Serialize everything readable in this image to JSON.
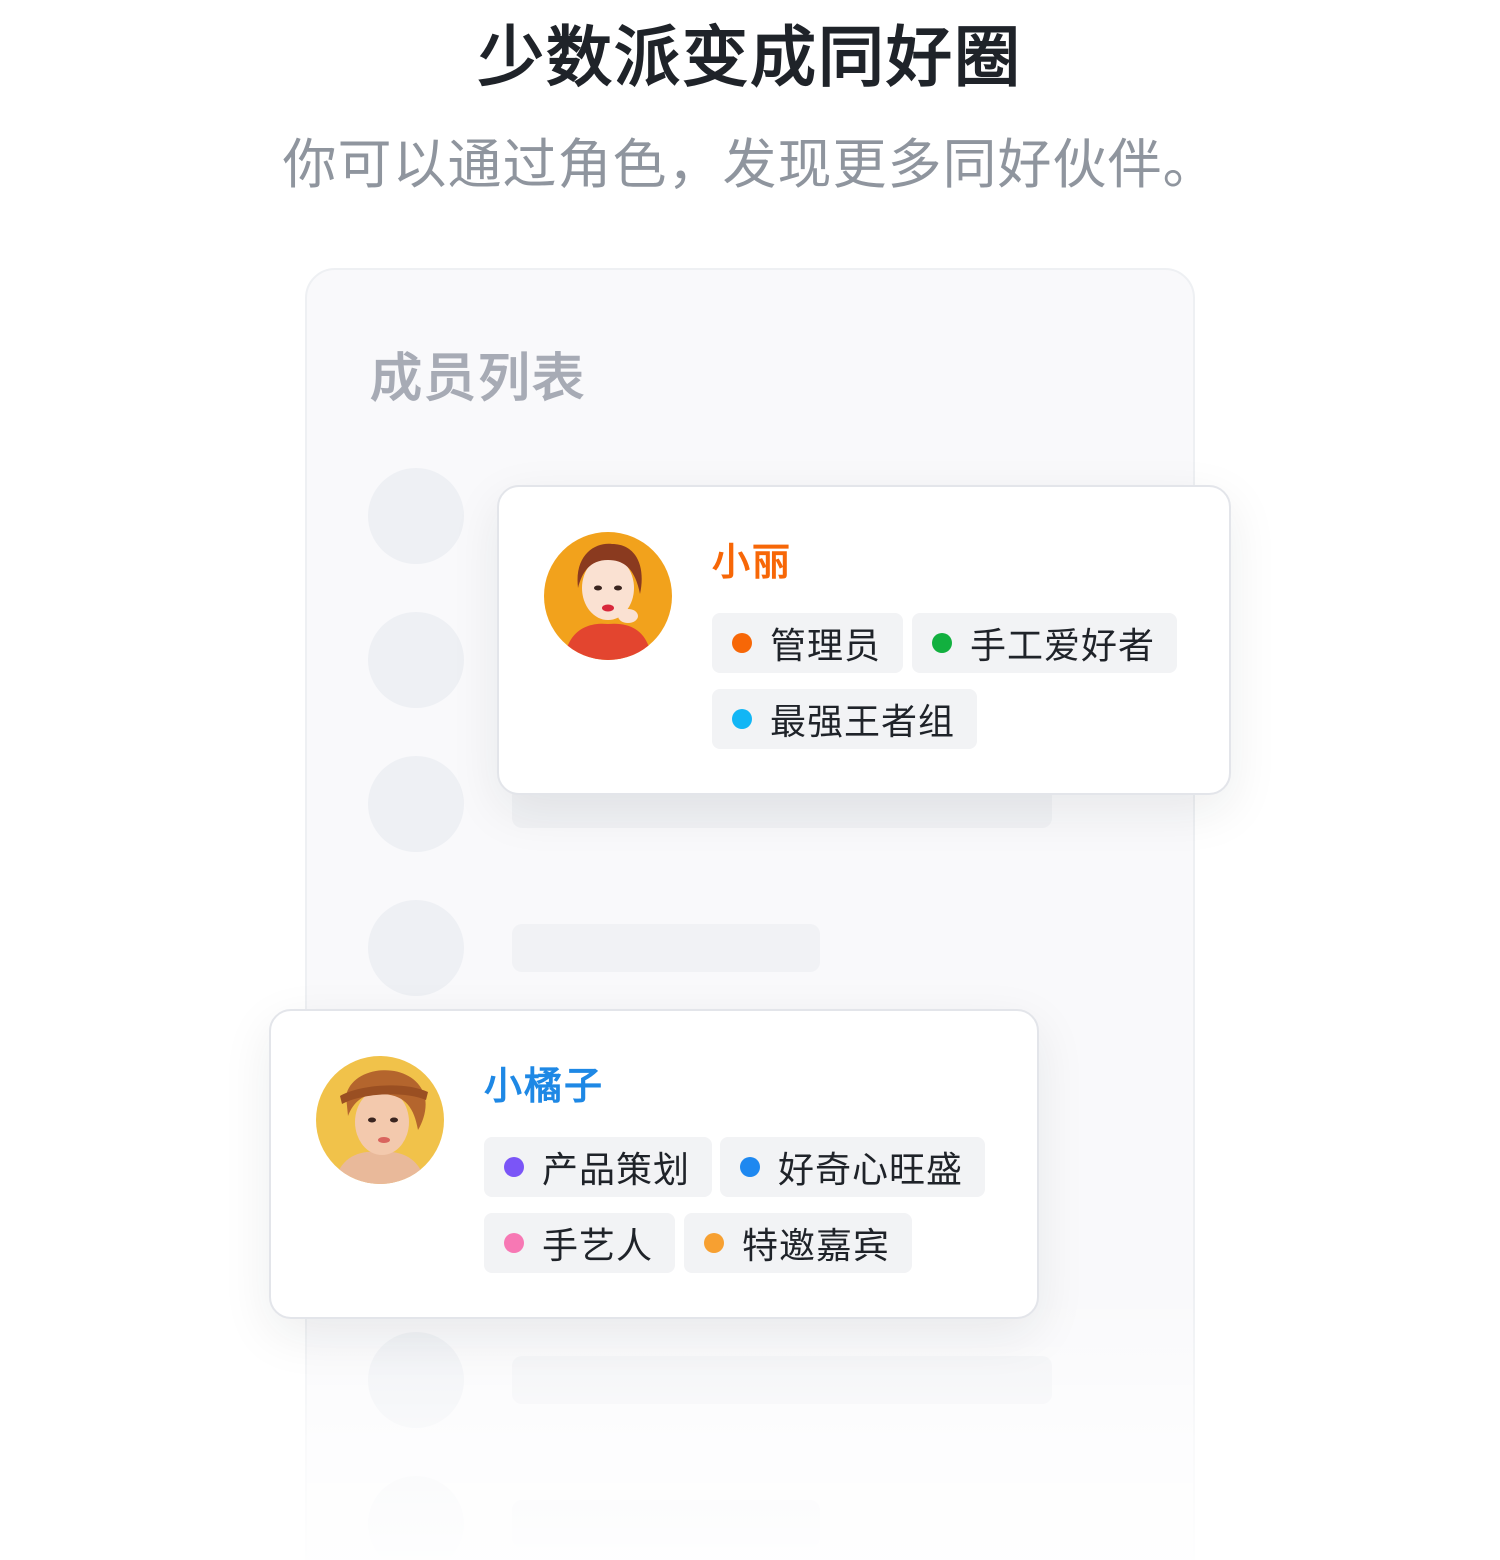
{
  "header": {
    "title": "少数派变成同好圈",
    "subtitle": "你可以通过角色，发现更多同好伙伴。"
  },
  "panel": {
    "title": "成员列表"
  },
  "members": [
    {
      "name": "小丽",
      "name_color": "#f76707",
      "tags": [
        {
          "label": "管理员",
          "color": "#f76707"
        },
        {
          "label": "手工爱好者",
          "color": "#12b03f"
        },
        {
          "label": "最强王者组",
          "color": "#12b6f5"
        }
      ]
    },
    {
      "name": "小橘子",
      "name_color": "#1e88e5",
      "tags": [
        {
          "label": "产品策划",
          "color": "#7b55f7"
        },
        {
          "label": "好奇心旺盛",
          "color": "#1e88f0"
        },
        {
          "label": "手艺人",
          "color": "#f778b4"
        },
        {
          "label": "特邀嘉宾",
          "color": "#f7a031"
        }
      ]
    }
  ]
}
